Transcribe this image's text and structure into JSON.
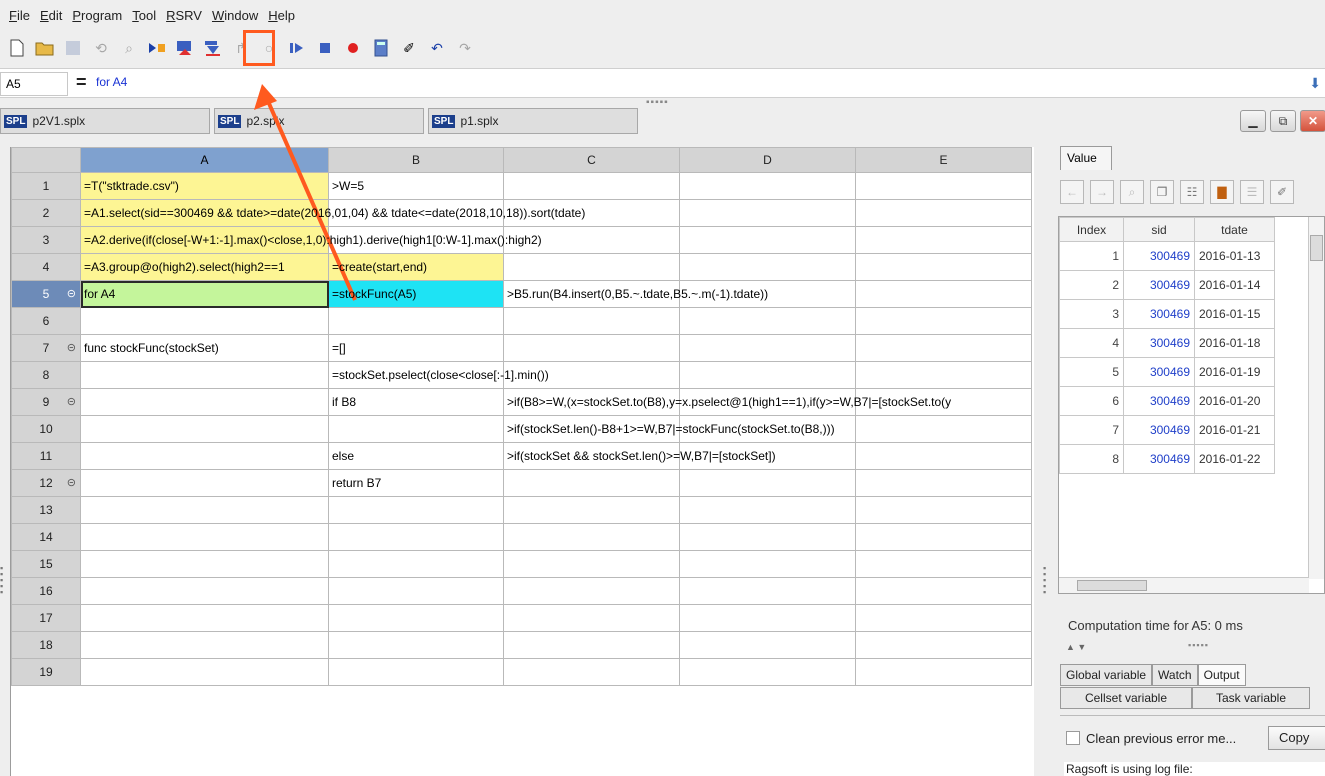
{
  "menu": [
    "File",
    "Edit",
    "Program",
    "Tool",
    "RSRV",
    "Window",
    "Help"
  ],
  "menu_underline": [
    "F",
    "E",
    "P",
    "T",
    "R",
    "W",
    "H"
  ],
  "toolbar": {
    "icons": [
      "new-file-icon",
      "open-file-icon",
      "save-icon",
      "undo-redo-icon",
      "search-icon",
      "run-to-cursor-icon",
      "step-over-icon",
      "step-into-icon",
      "step-return-icon",
      "breakpoint-icon",
      "resume-icon",
      "stop-icon",
      "record-icon",
      "calculator-icon",
      "clear-icon",
      "undo-icon",
      "redo-icon"
    ]
  },
  "formula": {
    "cell": "A5",
    "equals": "=",
    "value": "for A4"
  },
  "tabs": [
    {
      "badge": "SPL",
      "label": "p2V1.splx"
    },
    {
      "badge": "SPL",
      "label": "p2.splx"
    },
    {
      "badge": "SPL",
      "label": "p1.splx"
    }
  ],
  "grid": {
    "columns": [
      "A",
      "B",
      "C",
      "D",
      "E"
    ],
    "rows": [
      {
        "num": "1",
        "A": "=T(\"stktrade.csv\")",
        "B": ">W=5",
        "C": "",
        "D": "",
        "E": ""
      },
      {
        "num": "2",
        "A": "=A1.select(sid==300469 && tdate>=date(2016,01,04) && tdate<=date(2018,10,18)).sort(tdate)",
        "B": "",
        "C": "",
        "D": "",
        "E": ""
      },
      {
        "num": "3",
        "A": "=A2.derive(if(close[-W+1:-1].max()<close,1,0):high1).derive(high1[0:W-1].max():high2)",
        "B": "",
        "C": "",
        "D": "",
        "E": ""
      },
      {
        "num": "4",
        "A": "=A3.group@o(high2).select(high2==1",
        "B": "=create(start,end)",
        "C": "",
        "D": "",
        "E": ""
      },
      {
        "num": "5",
        "A": "for A4",
        "B": "=stockFunc(A5)",
        "C": ">B5.run(B4.insert(0,B5.~.tdate,B5.~.m(-1).tdate))",
        "D": "",
        "E": ""
      },
      {
        "num": "6",
        "A": "",
        "B": "",
        "C": "",
        "D": "",
        "E": ""
      },
      {
        "num": "7",
        "A": "func stockFunc(stockSet)",
        "B": "=[]",
        "C": "",
        "D": "",
        "E": ""
      },
      {
        "num": "8",
        "A": "",
        "B": "=stockSet.pselect(close<close[:-1].min())",
        "C": "",
        "D": "",
        "E": ""
      },
      {
        "num": "9",
        "A": "",
        "B": "if B8",
        "C": ">if(B8>=W,(x=stockSet.to(B8),y=x.pselect@1(high1==1),if(y>=W,B7|=[stockSet.to(y",
        "D": "",
        "E": ""
      },
      {
        "num": "10",
        "A": "",
        "B": "",
        "C": ">if(stockSet.len()-B8+1>=W,B7|=stockFunc(stockSet.to(B8,)))",
        "D": "",
        "E": ""
      },
      {
        "num": "11",
        "A": "",
        "B": "else",
        "C": ">if(stockSet && stockSet.len()>=W,B7|=[stockSet])",
        "D": "",
        "E": ""
      },
      {
        "num": "12",
        "A": "",
        "B": "return B7",
        "C": "",
        "D": "",
        "E": ""
      },
      {
        "num": "13",
        "A": "",
        "B": "",
        "C": "",
        "D": "",
        "E": ""
      },
      {
        "num": "14",
        "A": "",
        "B": "",
        "C": "",
        "D": "",
        "E": ""
      },
      {
        "num": "15",
        "A": "",
        "B": "",
        "C": "",
        "D": "",
        "E": ""
      },
      {
        "num": "16",
        "A": "",
        "B": "",
        "C": "",
        "D": "",
        "E": ""
      },
      {
        "num": "17",
        "A": "",
        "B": "",
        "C": "",
        "D": "",
        "E": ""
      },
      {
        "num": "18",
        "A": "",
        "B": "",
        "C": "",
        "D": "",
        "E": ""
      },
      {
        "num": "19",
        "A": "",
        "B": "",
        "C": "",
        "D": "",
        "E": ""
      }
    ],
    "fold_rows": [
      "5",
      "7",
      "9",
      "12"
    ],
    "selected_row": "5",
    "colors": {
      "yellow": "#fdf594",
      "green": "#c4f59b",
      "cyan": "#1ee3f4",
      "selected_header": "#7fa1cf"
    }
  },
  "value_panel": {
    "tab": "Value",
    "columns": [
      "Index",
      "sid",
      "tdate"
    ],
    "rows": [
      {
        "index": "1",
        "sid": "300469",
        "tdate": "2016-01-13"
      },
      {
        "index": "2",
        "sid": "300469",
        "tdate": "2016-01-14"
      },
      {
        "index": "3",
        "sid": "300469",
        "tdate": "2016-01-15"
      },
      {
        "index": "4",
        "sid": "300469",
        "tdate": "2016-01-18"
      },
      {
        "index": "5",
        "sid": "300469",
        "tdate": "2016-01-19"
      },
      {
        "index": "6",
        "sid": "300469",
        "tdate": "2016-01-20"
      },
      {
        "index": "7",
        "sid": "300469",
        "tdate": "2016-01-21"
      },
      {
        "index": "8",
        "sid": "300469",
        "tdate": "2016-01-22"
      }
    ],
    "computation_time": "Computation time for A5: 0 ms",
    "tabs_row1": [
      "Global variable",
      "Watch",
      "Output"
    ],
    "tabs_row2": [
      "Cellset variable",
      "Task variable"
    ],
    "clean_label": "Clean previous error me...",
    "copy_label": "Copy",
    "log_text": "Ragsoft is using log file:"
  },
  "annotation": {
    "color": "#ff5a1f"
  }
}
